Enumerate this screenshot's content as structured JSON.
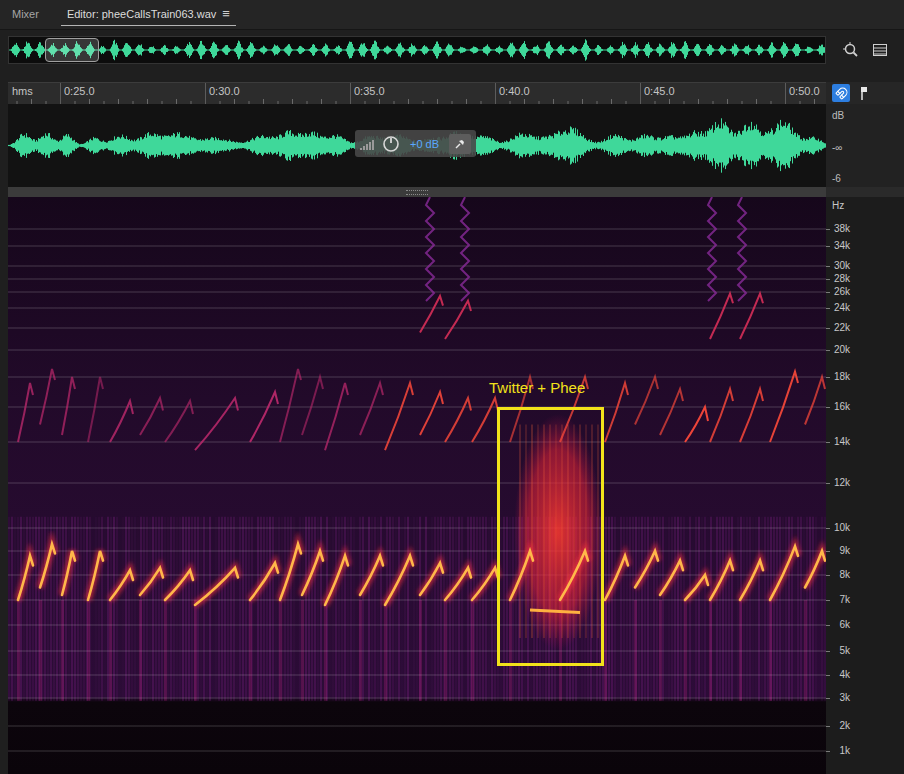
{
  "tabs": [
    {
      "label": "Mixer",
      "selected": false
    },
    {
      "label": "Editor: pheeCallsTrain063.wav",
      "selected": true
    }
  ],
  "tab_menu": "≡",
  "toolbar": {
    "snap": true
  },
  "time_ruler": {
    "unit": "hms",
    "ticks": [
      "0:25.0",
      "0:30.0",
      "0:35.0",
      "0:40.0",
      "0:45.0",
      "0:50.0"
    ]
  },
  "amplitude_ruler": {
    "unit": "dB",
    "ticks": [
      "-∞",
      "-6"
    ]
  },
  "hud": {
    "gain": "+0 dB"
  },
  "frequency_ruler": {
    "unit": "Hz",
    "ticks": [
      "38k",
      "34k",
      "30k",
      "28k",
      "26k",
      "24k",
      "22k",
      "20k",
      "18k",
      "16k",
      "14k",
      "12k",
      "10k",
      "9k",
      "8k",
      "7k",
      "6k",
      "5k",
      "4k",
      "3k",
      "2k",
      "1k"
    ]
  },
  "annotation": {
    "label": "Twitter + Phee"
  }
}
